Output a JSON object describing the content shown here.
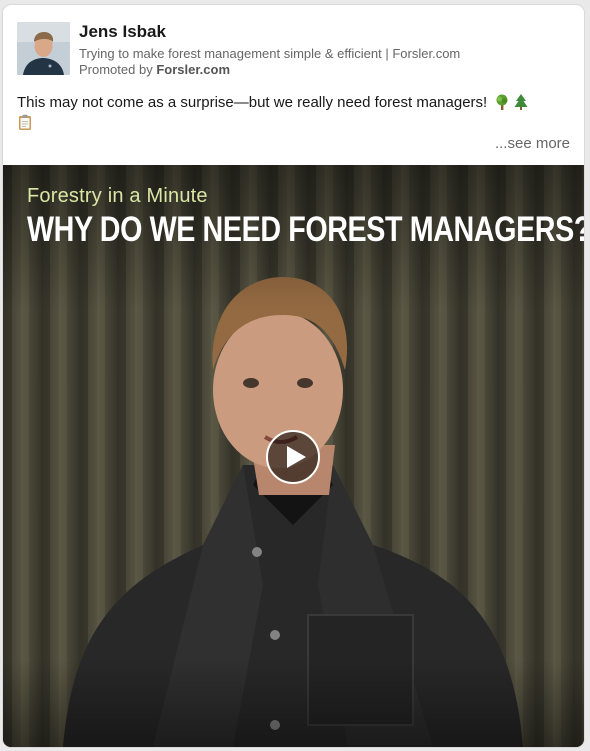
{
  "post": {
    "author_name": "Jens Isbak",
    "headline": "Trying to make forest management simple & efficient | Forsler.com",
    "promoted_prefix": "Promoted by",
    "promoted_by": "Forsler.com",
    "body": "This may not come as a surprise—but we really need forest managers!",
    "emojis": [
      "deciduous-tree-icon",
      "evergreen-tree-icon",
      "clipboard-icon"
    ],
    "see_more_label": "...see more"
  },
  "video": {
    "kicker": "Forestry in a Minute",
    "title": "WHY DO WE NEED FOREST MANAGERS?",
    "play_icon": "play-icon"
  },
  "colors": {
    "card_bg": "#ffffff",
    "page_bg": "#e9e9e9",
    "muted_text": "#666666",
    "kicker_green": "#d9e6a4"
  }
}
